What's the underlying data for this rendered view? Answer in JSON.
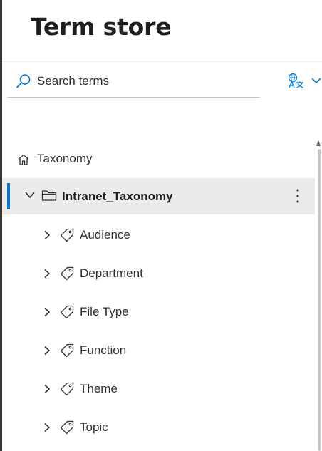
{
  "header": {
    "title": "Term store"
  },
  "search": {
    "placeholder": "Search terms",
    "value": ""
  },
  "language_button": {
    "icon": "language-translate-icon"
  },
  "tree": {
    "root": {
      "label": "Taxonomy",
      "icon": "home-icon"
    },
    "group": {
      "label": "Intranet_Taxonomy",
      "expanded": true,
      "selected": true,
      "icon": "folder-icon"
    },
    "term_sets": [
      {
        "label": "Audience"
      },
      {
        "label": "Department"
      },
      {
        "label": "File Type"
      },
      {
        "label": "Function"
      },
      {
        "label": "Theme"
      },
      {
        "label": "Topic"
      }
    ]
  },
  "colors": {
    "accent": "#0078d4",
    "selected_bg": "#edebe9",
    "text": "#323130"
  }
}
